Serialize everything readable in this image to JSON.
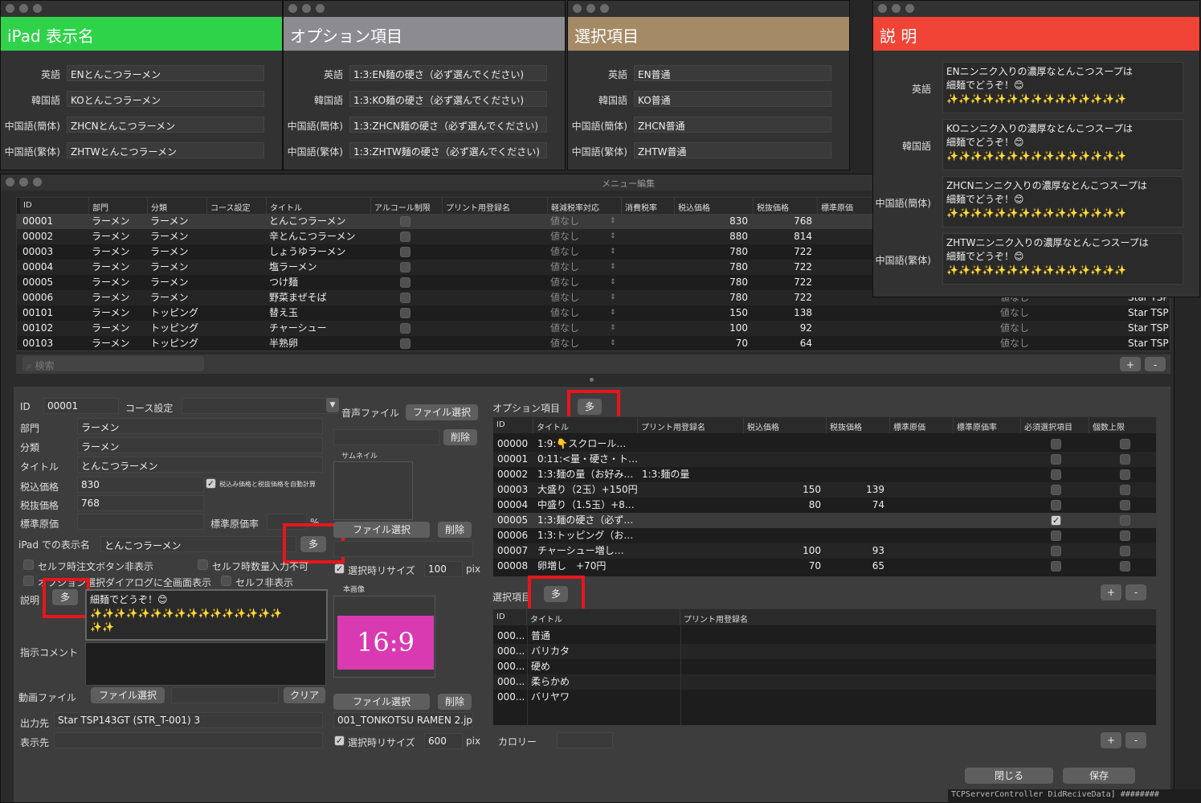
{
  "top_windows": [
    {
      "title": "iPad 表示名",
      "color": "#2fd34a",
      "rows": [
        [
          "英語",
          "ENとんこつラーメン"
        ],
        [
          "韓国語",
          "KOとんこつラーメン"
        ],
        [
          "中国語(簡体)",
          "ZHCNとんこつラーメン"
        ],
        [
          "中国語(繁体)",
          "ZHTWとんこつラーメン"
        ]
      ]
    },
    {
      "title": "オプション項目",
      "color": "#8c8c90",
      "rows": [
        [
          "英語",
          "1:3:EN麺の硬さ（必ず選んでください)"
        ],
        [
          "韓国語",
          "1:3:KO麺の硬さ（必ず選んでください)"
        ],
        [
          "中国語(簡体)",
          "1:3:ZHCN麺の硬さ（必ず選んでください)"
        ],
        [
          "中国語(繁体)",
          "1:3:ZHTW麺の硬さ（必ず選んでください)"
        ]
      ]
    },
    {
      "title": "選択項目",
      "color": "#a48a65",
      "rows": [
        [
          "英語",
          "EN普通"
        ],
        [
          "韓国語",
          "KO普通"
        ],
        [
          "中国語(簡体)",
          "ZHCN普通"
        ],
        [
          "中国語(繁体)",
          "ZHTW普通"
        ]
      ]
    }
  ],
  "desc_window": {
    "title": "説 明",
    "color": "#ef4436",
    "rows": [
      [
        "英語",
        "ENニンニク入りの濃厚なとんこつスープは\n細麺でどうぞ！😊\n✨✨✨✨✨✨✨✨✨✨✨✨✨✨✨"
      ],
      [
        "韓国語",
        "KOニンニク入りの濃厚なとんこつスープは\n細麺でどうぞ！😊\n✨✨✨✨✨✨✨✨✨✨✨✨✨✨✨"
      ],
      [
        "中国語(簡体)",
        "ZHCNニンニク入りの濃厚なとんこつスープは\n細麺でどうぞ！😊\n✨✨✨✨✨✨✨✨✨✨✨✨✨✨✨"
      ],
      [
        "中国語(繁体)",
        "ZHTWニンニク入りの濃厚なとんこつスープは\n細麺でどうぞ！😊\n✨✨✨✨✨✨✨✨✨✨✨✨✨✨✨"
      ]
    ]
  },
  "main_window": {
    "title": "メニュー編集",
    "menu_table": {
      "headers": [
        "ID",
        "部門",
        "分類",
        "コース設定",
        "タイトル",
        "アルコール制限",
        "プリント用登録名",
        "軽減税率対応",
        "消費税率",
        "税込価格",
        "税抜価格",
        "標準原価"
      ],
      "rows": [
        [
          "00001",
          "ラーメン",
          "ラーメン",
          "とんこつラーメン",
          "値なし",
          "830",
          "768"
        ],
        [
          "00002",
          "ラーメン",
          "ラーメン",
          "辛とんこつラーメン",
          "値なし",
          "880",
          "814"
        ],
        [
          "00003",
          "ラーメン",
          "ラーメン",
          "しょうゆラーメン",
          "値なし",
          "780",
          "722"
        ],
        [
          "00004",
          "ラーメン",
          "ラーメン",
          "塩ラーメン",
          "値なし",
          "780",
          "722"
        ],
        [
          "00005",
          "ラーメン",
          "ラーメン",
          "つけ麺",
          "値なし",
          "780",
          "722"
        ],
        [
          "00006",
          "ラーメン",
          "ラーメン",
          "野菜まぜそば",
          "値なし",
          "780",
          "722"
        ],
        [
          "00101",
          "ラーメン",
          "トッピング",
          "替え玉",
          "値なし",
          "150",
          "138"
        ],
        [
          "00102",
          "ラーメン",
          "トッピング",
          "チャーシュー",
          "値なし",
          "100",
          "92"
        ],
        [
          "00103",
          "ラーメン",
          "トッピング",
          "半熟卵",
          "値なし",
          "70",
          "64"
        ]
      ],
      "right_rows": [
        [
          "値なし",
          "Star TSP"
        ],
        [
          "値なし",
          "Star TSP"
        ],
        [
          "値なし",
          "Star TSP"
        ],
        [
          "値なし",
          "Star TSP"
        ]
      ],
      "search_placeholder": "検索"
    },
    "detail": {
      "id_label": "ID",
      "id_value": "00001",
      "course_label": "コース設定",
      "dept_label": "部門",
      "dept_value": "ラーメン",
      "class_label": "分類",
      "class_value": "ラーメン",
      "title_label": "タイトル",
      "title_value": "とんこつラーメン",
      "taxin_label": "税込価格",
      "taxin_value": "830",
      "auto_calc_label": "税込み価格と税抜価格を自動計算",
      "taxout_label": "税抜価格",
      "taxout_value": "768",
      "cost_label": "標準原価",
      "cost_rate_label": "標準原価率",
      "percent": "%",
      "ipad_label": "iPad での表示名",
      "ipad_value": "とんこつラーメン",
      "multi": "多",
      "chk1": "セルフ時注文ボタン非表示",
      "chk2": "セルフ時数量入力不可",
      "chk3": "オプション選択ダイアログに全画面表示",
      "chk4": "セルフ非表示",
      "desc_label": "説明",
      "desc_value": "細麺でどうぞ！😊\n✨✨✨✨✨✨✨✨✨✨✨✨✨✨✨✨\n✨✨",
      "comment_label": "指示コメント",
      "video_label": "動画ファイル",
      "file_select": "ファイル選択",
      "clear": "クリア",
      "output_label": "出力先",
      "output_value": "Star TSP143GT (STR_T-001) 3",
      "display_label": "表示先",
      "audio_label": "音声ファイル",
      "delete": "削除",
      "thumb_label": "サムネイル",
      "resize_label": "選択時リサイズ",
      "resize1": "100",
      "pix": "pix",
      "main_image_label": "本画像",
      "ratio": "16:9",
      "ratio_color": "#d93ab2",
      "image_file": "001_TONKOTSU RAMEN 2.jpg",
      "resize2": "600"
    },
    "option_table": {
      "label": "オプション項目",
      "headers": [
        "ID",
        "タイトル",
        "プリント用登録名",
        "税込価格",
        "税抜価格",
        "標準原価",
        "標準原価率",
        "必須選択項目",
        "個数上限"
      ],
      "rows": [
        [
          "00000",
          "1:9:👇スクロール…",
          "",
          "",
          "",
          false
        ],
        [
          "00001",
          "0:11:<量・硬さ・ト…",
          "",
          "",
          "",
          false
        ],
        [
          "00002",
          "1:3:麺の量（お好み…",
          "1:3:麺の量",
          "",
          "",
          false
        ],
        [
          "00003",
          "大盛り（2玉）+150円",
          "",
          "150",
          "139",
          false
        ],
        [
          "00004",
          "中盛り（1.5玉）+8…",
          "",
          "80",
          "74",
          false
        ],
        [
          "00005",
          "1:3:麺の硬さ（必ず…",
          "",
          "",
          "",
          true
        ],
        [
          "00006",
          "1:3:トッピング（お…",
          "",
          "",
          "",
          false
        ],
        [
          "00007",
          "チャーシュー増し…",
          "",
          "100",
          "93",
          false
        ],
        [
          "00008",
          "卵増し　+70円",
          "",
          "70",
          "65",
          false
        ]
      ]
    },
    "select_table": {
      "label": "選択項目",
      "headers": [
        "ID",
        "タイトル",
        "プリント用登録名"
      ],
      "rows": [
        [
          "000...",
          "普通"
        ],
        [
          "000...",
          "バリカタ"
        ],
        [
          "000...",
          "硬め"
        ],
        [
          "000...",
          "柔らかめ"
        ],
        [
          "000...",
          "バリヤワ"
        ]
      ]
    },
    "calorie_label": "カロリー",
    "plus": "+",
    "minus": "-",
    "close_btn": "閉じる",
    "save_btn": "保存"
  },
  "console_text": "TCPServerController DidReciveData] ########"
}
